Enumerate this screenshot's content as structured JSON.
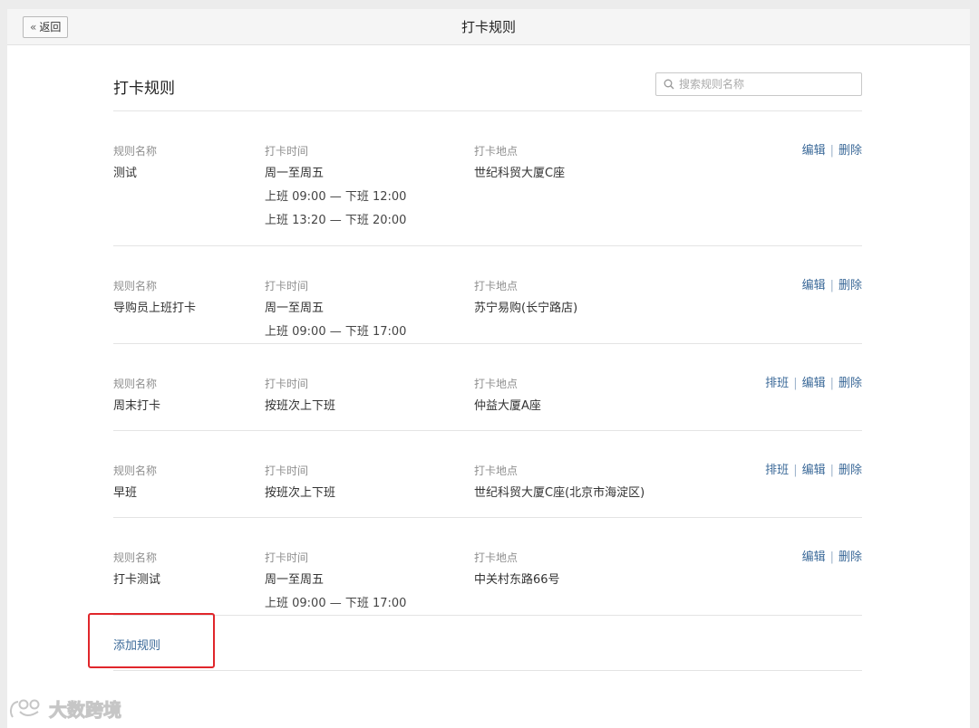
{
  "topbar": {
    "back_label": "返回",
    "title": "打卡规则"
  },
  "page": {
    "title": "打卡规则",
    "search_placeholder": "搜索规则名称"
  },
  "labels": {
    "name": "规则名称",
    "time": "打卡时间",
    "location": "打卡地点"
  },
  "actions": {
    "schedule": "排班",
    "edit": "编辑",
    "delete": "删除"
  },
  "rules": [
    {
      "name": "测试",
      "time_main": "周一至周五",
      "time_slots": [
        "上班 09:00  —  下班 12:00",
        "上班 13:20  —  下班 20:00"
      ],
      "location": "世纪科贸大厦C座",
      "has_schedule": false
    },
    {
      "name": "导购员上班打卡",
      "time_main": "周一至周五",
      "time_slots": [
        "上班 09:00  —  下班 17:00"
      ],
      "location": "苏宁易购(长宁路店)",
      "has_schedule": false
    },
    {
      "name": "周末打卡",
      "time_main": "按班次上下班",
      "time_slots": [],
      "location": "仲益大厦A座",
      "has_schedule": true
    },
    {
      "name": "早班",
      "time_main": "按班次上下班",
      "time_slots": [],
      "location": "世纪科贸大厦C座(北京市海淀区)",
      "has_schedule": true
    },
    {
      "name": "打卡测试",
      "time_main": "周一至周五",
      "time_slots": [
        "上班 09:00  —  下班 17:00"
      ],
      "location": "中关村东路66号",
      "has_schedule": false
    }
  ],
  "add_rule_label": "添加规则",
  "watermark": "大数跨境",
  "colors": {
    "link": "#3c6a99",
    "highlight": "#e0262b"
  }
}
